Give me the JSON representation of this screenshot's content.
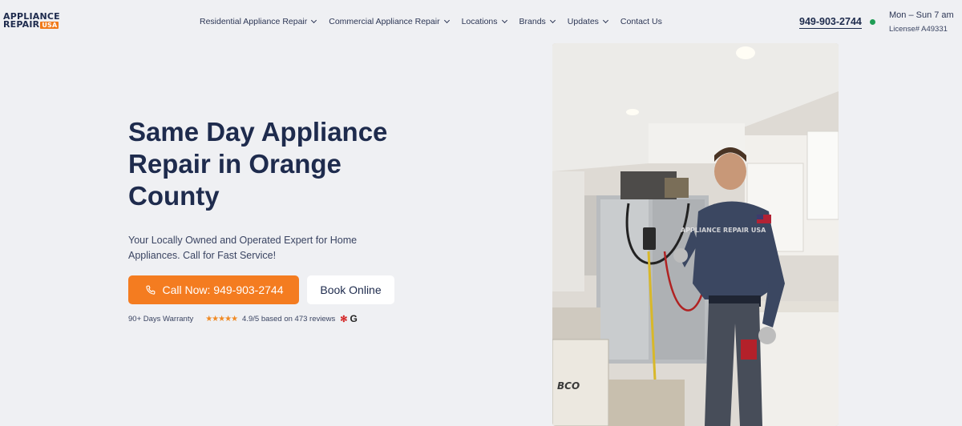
{
  "header": {
    "logo_line1": "APPLIANCE",
    "logo_line2": "REPAIR",
    "logo_badge": "USA",
    "nav": [
      {
        "label": "Residential Appliance Repair",
        "dropdown": true
      },
      {
        "label": "Commercial Appliance Repair",
        "dropdown": true
      },
      {
        "label": "Locations",
        "dropdown": true
      },
      {
        "label": "Brands",
        "dropdown": true
      },
      {
        "label": "Updates",
        "dropdown": true
      },
      {
        "label": "Contact Us",
        "dropdown": false
      }
    ],
    "phone": "949-903-2744",
    "hours": "Mon – Sun   7 am",
    "license": "License# A49331",
    "status_color": "#1f9d55"
  },
  "hero": {
    "title": "Same Day Appliance Repair in Orange County",
    "subtitle": "Your Locally Owned and Operated Expert for Home Appliances. Call for Fast Service!",
    "call_button": "Call Now: 949-903-2744",
    "book_button": "Book Online",
    "warranty": "90+ Days Warranty",
    "rating": 4.9,
    "stars": "★★★★★",
    "review_text": "4.9/5 based on 473 reviews",
    "google_icon_letter": "G",
    "accent_color": "#f47c20"
  },
  "photo": {
    "shirt_logo": "APPLIANCE REPAIR USA",
    "box_text": "BCO"
  }
}
